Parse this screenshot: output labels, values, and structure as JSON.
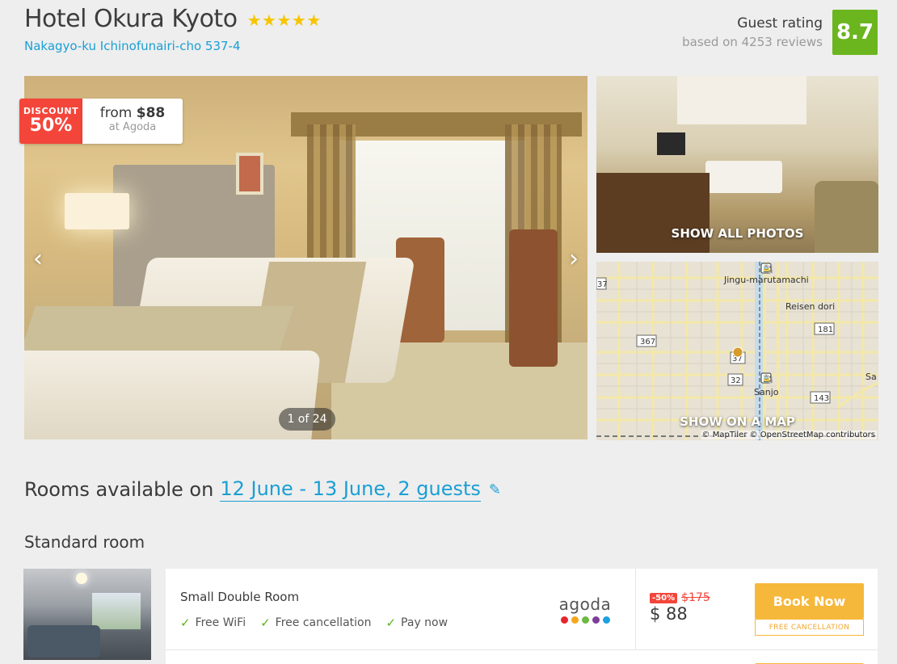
{
  "hotel": {
    "name": "Hotel Okura Kyoto",
    "stars": 5,
    "address": "Nakagyo-ku Ichinofunairi-cho 537-4"
  },
  "rating": {
    "label": "Guest rating",
    "reviews": "based on 4253 reviews",
    "score": "8.7",
    "score_color": "#6bb51e"
  },
  "gallery": {
    "discount_label": "DISCOUNT",
    "discount_value": "50%",
    "price_prefix": "from ",
    "price": "$88",
    "price_source": "at Agoda",
    "counter": "1 of 24",
    "prev_icon": "chevron-left-icon",
    "next_icon": "chevron-right-icon",
    "show_all_photos": "SHOW ALL PHOTOS",
    "show_on_map": "SHOW ON A MAP"
  },
  "map": {
    "labels": {
      "jingu": "Jingu-marutamachi",
      "reisen": "Reisen dori",
      "sanjo": "Sanjo",
      "sa": "Sa"
    },
    "shields": {
      "r367": "367",
      "r181": "181",
      "r37": "37",
      "r32": "32",
      "r143": "143",
      "r37_left": "37"
    },
    "attribution": "© MapTiler © OpenStreetMap contributors"
  },
  "rooms": {
    "heading_prefix": "Rooms available on",
    "dates": "12 June - 13 June, 2 guests",
    "edit_icon": "pencil-icon",
    "type": "Standard room"
  },
  "offer": {
    "room_name": "Small Double Room",
    "features": [
      "Free WiFi",
      "Free cancellation",
      "Pay now"
    ],
    "provider": "agoda",
    "provider_dots": [
      "#e4262c",
      "#f2a81d",
      "#6db944",
      "#7b3f98",
      "#1da1dd"
    ],
    "discount_badge": "-50%",
    "old_price": "$175",
    "new_price": "$ 88",
    "book_label": "Book Now",
    "cancel_tag": "FREE CANCELLATION",
    "accent_color": "#f6b83a"
  }
}
